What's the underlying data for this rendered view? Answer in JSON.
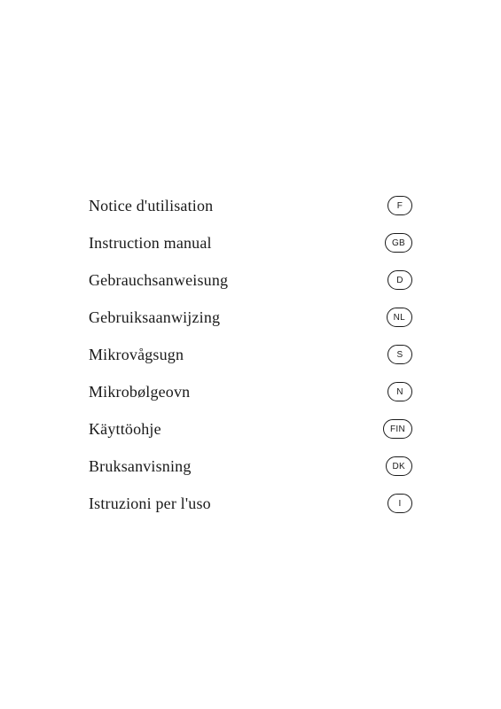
{
  "items": [
    {
      "label": "Notice d'utilisation",
      "badge": "F"
    },
    {
      "label": "Instruction manual",
      "badge": "GB"
    },
    {
      "label": "Gebrauchsanweisung",
      "badge": "D"
    },
    {
      "label": "Gebruiksaanwijzing",
      "badge": "NL"
    },
    {
      "label": "Mikrovågsugn",
      "badge": "S"
    },
    {
      "label": "Mikrobølgeovn",
      "badge": "N"
    },
    {
      "label": "Käyttöohje",
      "badge": "FIN"
    },
    {
      "label": "Bruksanvisning",
      "badge": "DK"
    },
    {
      "label": "Istruzioni per l'uso",
      "badge": "I"
    }
  ]
}
